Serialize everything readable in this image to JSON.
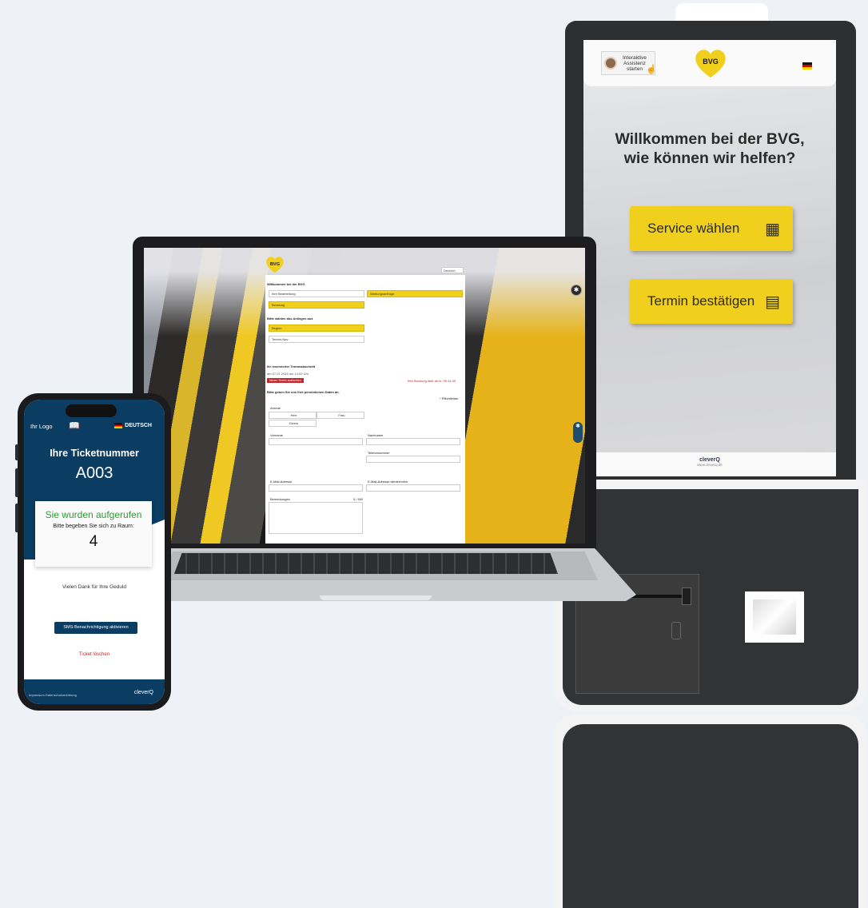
{
  "kiosk": {
    "assist_label": "Interaktive\nAssistenz\nstarten",
    "bvg_logo": "BVG",
    "welcome": "Willkommen bei der BVG,\nwie können wir helfen?",
    "btn_service": "Service wählen",
    "btn_appointment": "Termin bestätigen",
    "footer_brand": "cleverQ",
    "footer_url": "www.cleverq.de",
    "brand_yellow": "#f0d01c"
  },
  "laptop": {
    "bvg_logo": "BVG",
    "lang": "Deutsch",
    "welcome": "Willkommen bei der BVG",
    "row1_left": "Ihre Bearbeitung",
    "row1_right": "Wartungsanfrage",
    "row2": "Beratung",
    "choose": "Bitte wählen das Anliegen aus",
    "option1": "Beginn",
    "option2": "Termin-Nav",
    "appt_label": "Ihr reservierter Terminabschnitt",
    "appt_date": "am 07.01.2026 um 14:00 Uhr",
    "appt_btn": "Neuen Termin ausbuchen",
    "appt_time_right": "Ihre Buchung läuft ab in: 09:14:40",
    "personal": "Bitte geben Sie uns Ihre persönlichen Daten an.",
    "salutation": "Anrede",
    "herr": "Herr",
    "frau": "Frau",
    "divers": "Divers",
    "first_name": "Vorname",
    "last_name": "Nachname",
    "phone": "Telefonnummer",
    "email": "E-Mail-Adresse",
    "email2": "E-Mail-Adresse wiederholen",
    "remarks": "Bemerkungen",
    "remarks_count": "0 / 500",
    "mandatory": "* Pflichtfelder"
  },
  "phone": {
    "logo": "Ihr Logo",
    "lang": "DEUTSCH",
    "title": "Ihre Ticketnummer",
    "ticket": "A003",
    "called": "Sie wurden aufgerufen",
    "room_label": "Bitte begeben Sie sich zu Raum:",
    "room": "4",
    "thanks": "Vielen Dank für Ihre Geduld",
    "sms_btn": "SMS-Benachrichtigung aktivieren",
    "delete": "Ticket löschen",
    "footer_links": "Impressum   Datenschutzerklärung",
    "footer_brand": "cleverQ",
    "primary_color": "#0b3c62",
    "called_color": "#2f9b34",
    "delete_color": "#d01f1f"
  }
}
